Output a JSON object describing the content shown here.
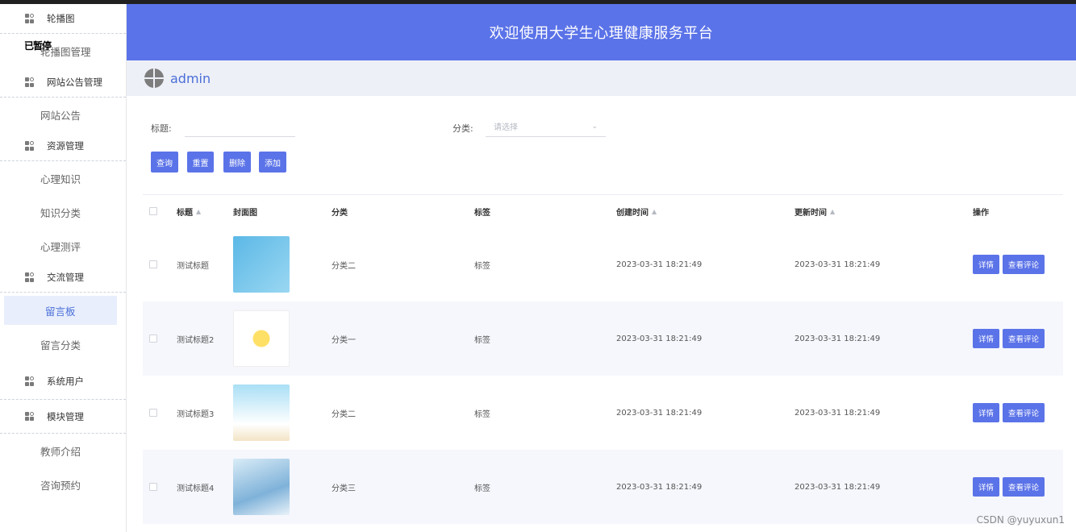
{
  "header": {
    "title": "欢迎使用大学生心理健康服务平台"
  },
  "user": {
    "name": "admin"
  },
  "overlay_text": "已暂停",
  "sidebar": {
    "items": [
      {
        "type": "group",
        "label": "轮播图"
      },
      {
        "type": "item",
        "label": "轮播图管理"
      },
      {
        "type": "group",
        "label": "网站公告管理"
      },
      {
        "type": "item",
        "label": "网站公告"
      },
      {
        "type": "group",
        "label": "资源管理"
      },
      {
        "type": "item",
        "label": "心理知识"
      },
      {
        "type": "item",
        "label": "知识分类"
      },
      {
        "type": "item",
        "label": "心理测评"
      },
      {
        "type": "group",
        "label": "交流管理"
      },
      {
        "type": "item",
        "label": "留言板",
        "active": true
      },
      {
        "type": "item",
        "label": "留言分类"
      },
      {
        "type": "group",
        "label": "系统用户"
      },
      {
        "type": "group",
        "label": "模块管理"
      },
      {
        "type": "item",
        "label": "教师介绍"
      },
      {
        "type": "item",
        "label": "咨询预约"
      }
    ]
  },
  "filters": {
    "title_label": "标题:",
    "title_value": "",
    "category_label": "分类:",
    "category_placeholder": "请选择"
  },
  "buttons": {
    "query": "查询",
    "reset": "重置",
    "delete": "删除",
    "add": "添加"
  },
  "table": {
    "columns": {
      "title": "标题",
      "cover": "封面图",
      "category": "分类",
      "tag": "标签",
      "created": "创建时间",
      "updated": "更新时间",
      "ops": "操作"
    },
    "rows": [
      {
        "title": "测试标题",
        "category": "分类二",
        "tag": "标签",
        "created": "2023-03-31 18:21:49",
        "updated": "2023-03-31 18:21:49"
      },
      {
        "title": "测试标题2",
        "category": "分类一",
        "tag": "标签",
        "created": "2023-03-31 18:21:49",
        "updated": "2023-03-31 18:21:49"
      },
      {
        "title": "测试标题3",
        "category": "分类二",
        "tag": "标签",
        "created": "2023-03-31 18:21:49",
        "updated": "2023-03-31 18:21:49"
      },
      {
        "title": "测试标题4",
        "category": "分类三",
        "tag": "标签",
        "created": "2023-03-31 18:21:49",
        "updated": "2023-03-31 18:21:49"
      }
    ],
    "row_actions": {
      "detail": "详情",
      "comments": "查看评论"
    }
  },
  "watermark": "CSDN @yuyuxun1",
  "colors": {
    "primary": "#5b73e8",
    "active_bg": "#e8eefc"
  }
}
